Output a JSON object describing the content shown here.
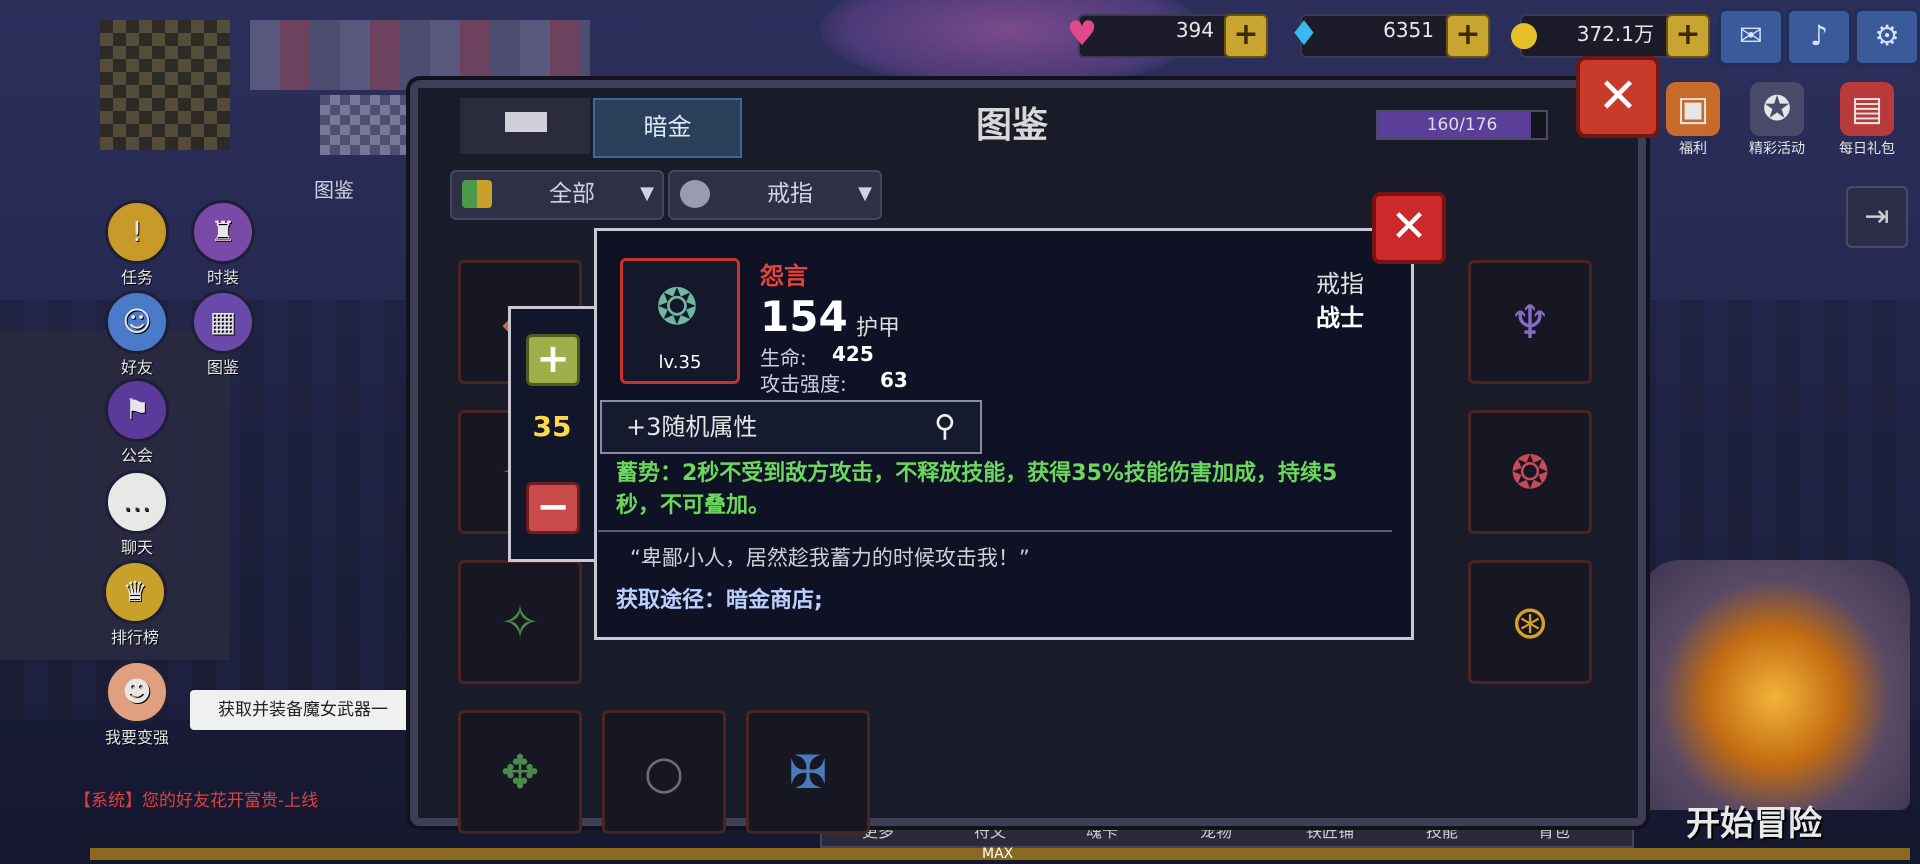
{
  "currency": {
    "hearts": "394",
    "diamonds": "6351",
    "gold": "372.1万"
  },
  "events": [
    {
      "label": "福利"
    },
    {
      "label": "精彩活动"
    },
    {
      "label": "每日礼包"
    }
  ],
  "side_menu": [
    {
      "label": "任务"
    },
    {
      "label": "时装"
    },
    {
      "label": "好友"
    },
    {
      "label": "图鉴"
    },
    {
      "label": "公会"
    },
    {
      "label": "聊天"
    },
    {
      "label": "排行榜"
    },
    {
      "label": "我要变强"
    }
  ],
  "player_label": "图鉴",
  "tip": "获取并装备魔女武器一",
  "system_message": "【系统】您的好友花开富贵-上线",
  "bottom_tabs": [
    "更多",
    "符文",
    "魂卡",
    "宠物",
    "铁匠铺",
    "技能",
    "背包"
  ],
  "max_label": "MAX",
  "start_button": "开始冒险",
  "codex": {
    "title": "图鉴",
    "tab_active": "暗金",
    "progress_text": "160/176",
    "progress_fraction": 0.909,
    "filter_all": "全部",
    "filter_type": "戒指"
  },
  "item": {
    "name": "怨言",
    "armor_value": "154",
    "armor_label": "护甲",
    "level": "lv.35",
    "hp_label": "生命:",
    "hp_value": "425",
    "atk_label": "攻击强度:",
    "atk_value": "63",
    "type": "戒指",
    "class": "战士",
    "random_attr": "+3随机属性",
    "skill_text": "蓄势：2秒不受到敌方攻击，不释放技能，获得35%技能伤害加成，持续5秒，不可叠加。",
    "quote": "“卑鄙小人，居然趁我蓄力的时候攻击我！”",
    "source": "获取途径：暗金商店;"
  },
  "stepper": {
    "value": "35"
  },
  "colors": {
    "item_name": "#e8423a",
    "skill_text": "#6bd85c",
    "stepper_value": "#ffd94a",
    "close_button": "#cc2a2a"
  }
}
